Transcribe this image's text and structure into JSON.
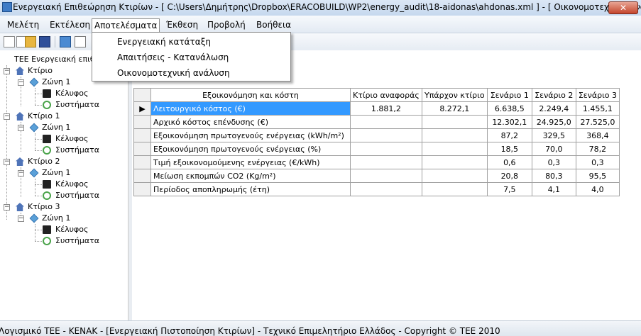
{
  "window": {
    "title": "Ενεργειακή Επιθεώρηση Κτιρίων - [ C:\\Users\\Δημήτρης\\Dropbox\\ERACOBUILD\\WP2\\energy_audit\\18-aidonas\\ahdonas.xml ] - [ Οικονομοτεχνική ανάλυση ]",
    "close_symbol": "✕"
  },
  "menu": {
    "items": [
      "Μελέτη",
      "Εκτέλεση",
      "Αποτελέσματα",
      "Έκθεση",
      "Προβολή",
      "Βοήθεια"
    ],
    "open_index": 2,
    "dropdown": [
      "Ενεργειακή κατάταξη",
      "Απαιτήσεις - Κατανάλωση",
      "Οικονομοτεχνική ανάλυση"
    ]
  },
  "toolbar": {
    "buttons": [
      "new-icon",
      "new-file-icon",
      "open-folder-icon",
      "save-icon",
      "image-icon",
      "print-preview-icon"
    ]
  },
  "tree": {
    "root": "ΤΕΕ Ενεργειακή επιθε",
    "buildings": [
      {
        "label": "Κτίριο",
        "zone": "Ζώνη 1",
        "envelope": "Κέλυφος",
        "systems": "Συστήματα"
      },
      {
        "label": "Κτίριο 1",
        "zone": "Ζώνη 1",
        "envelope": "Κέλυφος",
        "systems": "Συστήματα"
      },
      {
        "label": "Κτίριο 2",
        "zone": "Ζώνη 1",
        "envelope": "Κέλυφος",
        "systems": "Συστήματα"
      },
      {
        "label": "Κτίριο 3",
        "zone": "Ζώνη 1",
        "envelope": "Κέλυφος",
        "systems": "Συστήματα"
      }
    ]
  },
  "grid": {
    "headers": [
      "Εξοικονόμηση και κόστη",
      "Κτίριο αναφοράς",
      "Υπάρχον κτίριο",
      "Σενάριο 1",
      "Σενάριο 2",
      "Σενάριο 3"
    ],
    "rows": [
      {
        "label": "Λειτουργικό κόστος (€)",
        "values": [
          "1.881,2",
          "8.272,1",
          "6.638,5",
          "2.249,4",
          "1.455,1"
        ],
        "selected": true
      },
      {
        "label": "Αρχικό κόστος επένδυσης (€)",
        "values": [
          "",
          "",
          "12.302,1",
          "24.925,0",
          "27.525,0"
        ]
      },
      {
        "label": "Εξοικονόμηση πρωτογενούς ενέργειας (kWh/m²)",
        "values": [
          "",
          "",
          "87,2",
          "329,5",
          "368,4"
        ]
      },
      {
        "label": "Εξοικονόμηση πρωτογενούς ενέργειας (%)",
        "values": [
          "",
          "",
          "18,5",
          "70,0",
          "78,2"
        ]
      },
      {
        "label": "Τιμή εξοικονομούμενης ενέργειας (€/kWh)",
        "values": [
          "",
          "",
          "0,6",
          "0,3",
          "0,3"
        ]
      },
      {
        "label": "Μείωση εκπομπών CO2 (Kg/m²)",
        "values": [
          "",
          "",
          "20,8",
          "80,3",
          "95,5"
        ]
      },
      {
        "label": "Περίοδος αποπληρωμής (έτη)",
        "values": [
          "",
          "",
          "7,5",
          "4,1",
          "4,0"
        ]
      }
    ],
    "row_pointer": "▶"
  },
  "status": {
    "text": "Λογισμικό ΤΕΕ - ΚΕΝΑΚ  -  [Ενεργειακή Πιστοποίηση Κτιρίων]  -  Τεχνικό Επιμελητήριο Ελλάδος  -  Copyright © TEE 2010"
  },
  "colors": {
    "selection": "#3399ff",
    "title_bar": "#c6d8ee",
    "close_button": "#c4452c"
  }
}
